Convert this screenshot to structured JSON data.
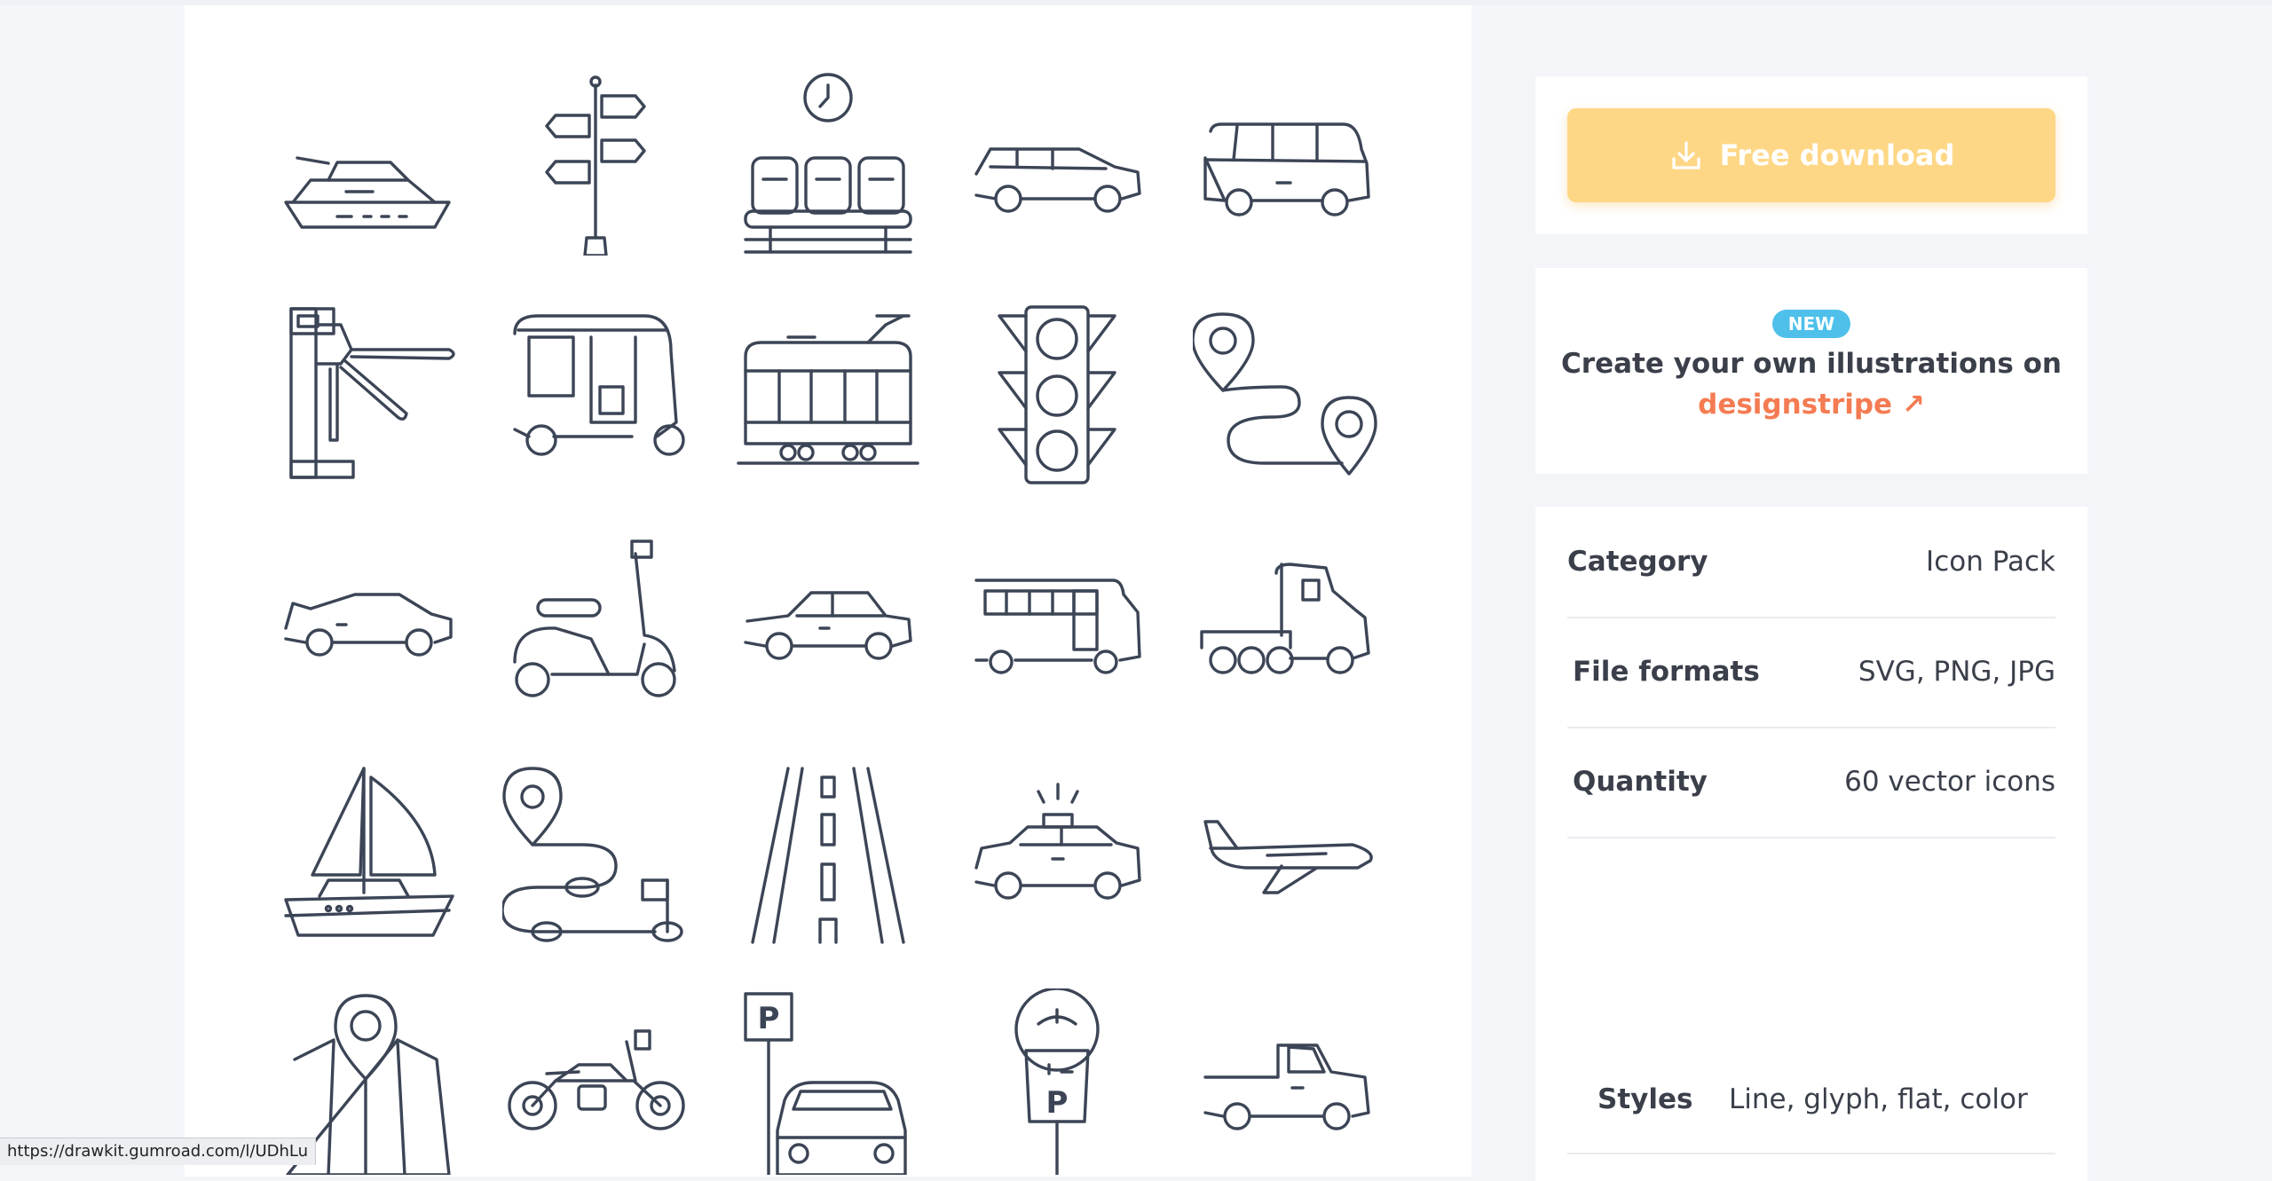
{
  "download": {
    "label": "Free download",
    "icon": "download-icon"
  },
  "promo": {
    "badge": "NEW",
    "text": "Create your own illustrations on",
    "link": "designstripe ↗"
  },
  "details": [
    {
      "label": "Category",
      "value": "Icon Pack"
    },
    {
      "label": "File formats",
      "value": "SVG, PNG, JPG"
    },
    {
      "label": "Quantity",
      "value": "60 vector icons"
    }
  ],
  "styles": {
    "label": "Styles",
    "value": "Line, glyph, flat, color"
  },
  "preview_icons": [
    "yacht-icon",
    "signpost-icon",
    "waiting-seats-icon",
    "suv-icon",
    "van-icon",
    "turnstile-icon",
    "tuk-tuk-icon",
    "tram-icon",
    "traffic-light-icon",
    "route-icon",
    "sports-car-icon",
    "scooter-icon",
    "sedan-icon",
    "bus-icon",
    "semi-truck-icon",
    "sailboat-icon",
    "route-flag-icon",
    "road-icon",
    "taxi-icon",
    "airplane-icon",
    "map-icon",
    "motorcycle-icon",
    "parking-icon",
    "parking-meter-icon",
    "pickup-truck-icon"
  ],
  "parking_letter": "P",
  "status_url": "https://drawkit.gumroad.com/l/UDhLu"
}
